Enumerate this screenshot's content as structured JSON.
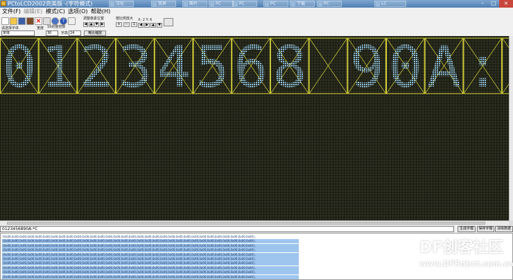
{
  "window": {
    "title": "PCtoLCD2002完美版 -(字符模式)",
    "taskbar_tabs": [
      "汉化",
      "宽屏",
      "图片",
      "PC",
      "PC",
      "PC",
      "下载",
      "PC",
      "LC"
    ]
  },
  "menu": [
    {
      "label": "文件(F)",
      "enabled": true
    },
    {
      "label": "编辑(E)",
      "enabled": false
    },
    {
      "label": "模式(C)",
      "enabled": true
    },
    {
      "label": "选项(O)",
      "enabled": true
    },
    {
      "label": "帮助(H)",
      "enabled": true
    }
  ],
  "toolbar": {
    "size_label": "16的整倍数",
    "adjust_label": "调整像素位置",
    "zoom_label": "按比例放大",
    "position_label": "X: 2 Y: 6",
    "font_label": "请选择字体",
    "font_value": "宋体",
    "width_label": "宽度",
    "width_value": "30",
    "height_label": "字高",
    "height_value": "24",
    "equal_ratio_label": "等比缩放"
  },
  "lcd": {
    "text": "01234568 90A:*"
  },
  "bottom": {
    "input_text": "0123456890A:*C",
    "generate_button": "生成字模",
    "save_button": "保存字模",
    "clear_button": "清除数据"
  },
  "code": {
    "line_text": "{0x00,0x00,0x00,0x00,0x00,0x00,0x00,0x00,0x00,0x00,0x00,0x00,0x00,0x00,0x00,0x00,0x00,0x00,0x00,0x00,0x00,0x00,0x00,0x00,0x00,0x00,0x00,0x00,0x00,0x00,0x00,0x00},"
  },
  "watermark": {
    "brand": "DF创客社区",
    "url": "www.DFRobot.com.cn"
  },
  "colors": {
    "lcd_background": "#2c2e1f",
    "lcd_pixel_on": "#8fc2e0",
    "lcd_cell_border": "#d8d43a",
    "selection": "#9ec5ee"
  }
}
